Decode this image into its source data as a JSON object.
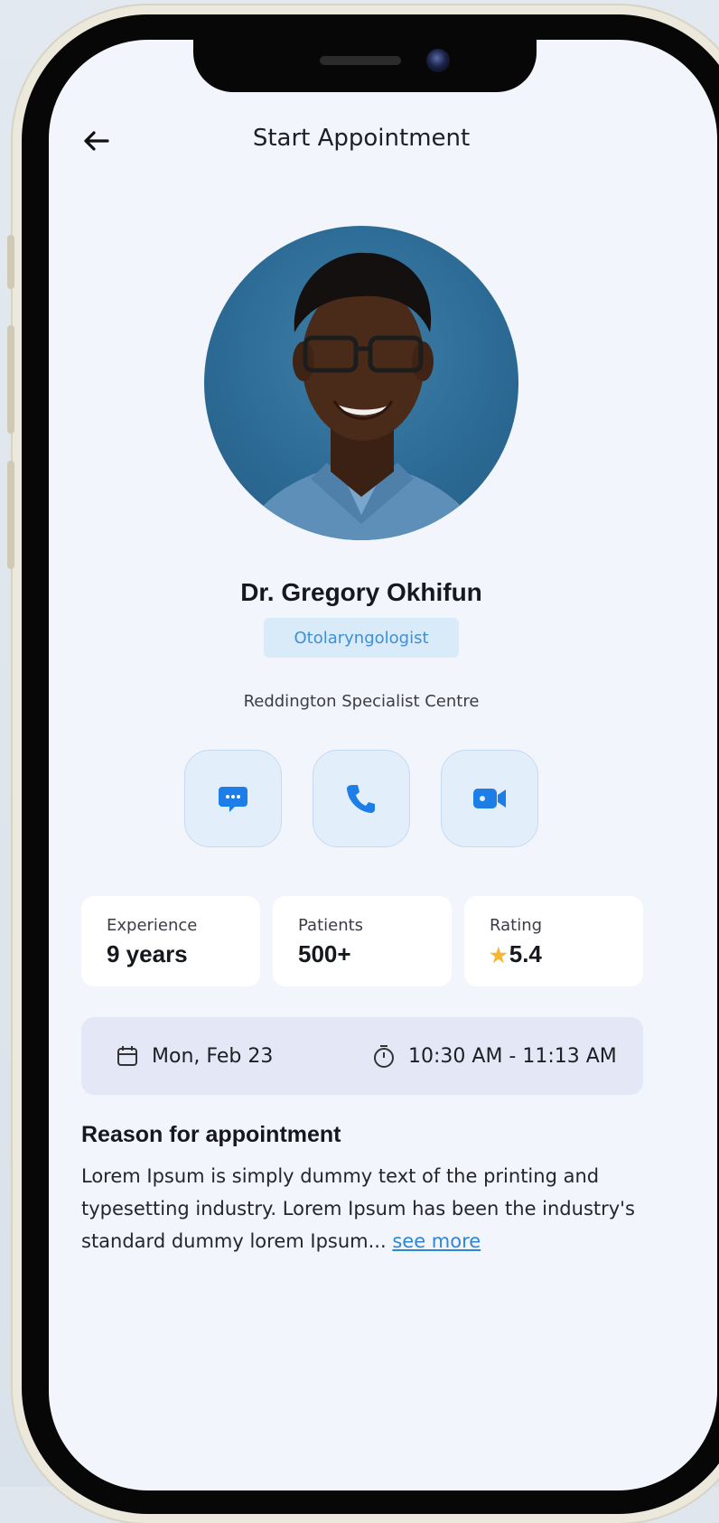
{
  "header": {
    "title": "Start Appointment",
    "back_icon": "arrow-left-icon"
  },
  "doctor": {
    "name": "Dr. Gregory Okhifun",
    "specialty": "Otolaryngologist",
    "hospital": "Reddington Specialist Centre"
  },
  "actions": [
    {
      "icon": "chat-icon",
      "label": "Message"
    },
    {
      "icon": "phone-icon",
      "label": "Call"
    },
    {
      "icon": "video-icon",
      "label": "Video call"
    }
  ],
  "stats": [
    {
      "label": "Experience",
      "value": "9 years"
    },
    {
      "label": "Patients",
      "value": "500+"
    },
    {
      "label": "Rating",
      "value": "5.4",
      "icon": "star-icon"
    }
  ],
  "schedule": {
    "date": "Mon, Feb 23",
    "time": "10:30 AM - 11:13 AM"
  },
  "reason": {
    "title": "Reason for appointment",
    "body": "Lorem Ipsum is simply dummy text of the printing and typesetting industry. Lorem Ipsum has been the industry's standard dummy lorem Ipsum...",
    "see_more": "see more"
  },
  "colors": {
    "accent": "#1c7ee6",
    "badge_bg": "#d9ebf9",
    "screen_bg": "#f2f5fb",
    "star": "#f5b631"
  }
}
